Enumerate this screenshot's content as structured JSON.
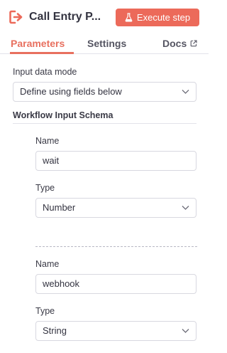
{
  "header": {
    "node_title": "Call Entry P...",
    "node_icon": "sign-in-icon",
    "execute_label": "Execute step",
    "execute_icon": "flask-icon",
    "accent": "#ec6a5a"
  },
  "tabs": {
    "parameters": "Parameters",
    "settings": "Settings",
    "docs": "Docs"
  },
  "input_mode": {
    "label": "Input data mode",
    "value": "Define using fields below"
  },
  "schema": {
    "title": "Workflow Input Schema",
    "fields": [
      {
        "name_label": "Name",
        "name_value": "wait",
        "type_label": "Type",
        "type_value": "Number"
      },
      {
        "name_label": "Name",
        "name_value": "webhook",
        "type_label": "Type",
        "type_value": "String"
      }
    ]
  }
}
